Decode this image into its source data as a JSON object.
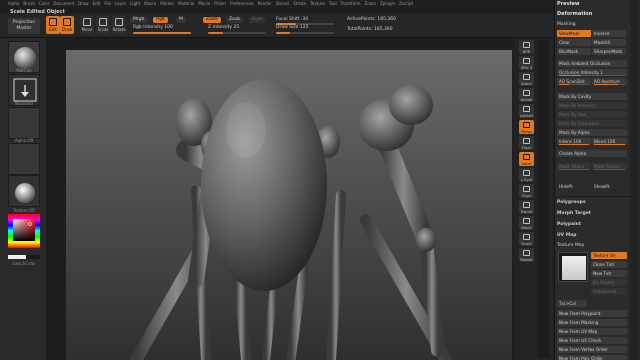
{
  "menu": [
    "Alpha",
    "Brush",
    "Color",
    "Document",
    "Draw",
    "Edit",
    "File",
    "Layer",
    "Light",
    "Macro",
    "Marker",
    "Material",
    "Movie",
    "Picker",
    "Preferences",
    "Render",
    "Stencil",
    "Stroke",
    "Texture",
    "Tool",
    "Transform",
    "Zoom",
    "Zplugin",
    "Zscript"
  ],
  "status_line": "Scale Edited Object",
  "shelf": {
    "projection_master": "Projection Master",
    "tools": [
      {
        "label": "Edit",
        "active": true
      },
      {
        "label": "Draw",
        "active": true
      },
      {
        "label": "Move",
        "active": false
      },
      {
        "label": "Scale",
        "active": false
      },
      {
        "label": "Rotate",
        "active": false
      }
    ],
    "mrgb": "Mrgb",
    "rgb": "Rgb",
    "m": "M",
    "rgb_intensity": "Rgb Intensity 100",
    "rgb_intensity_value": 1.0,
    "zadd": "Zadd",
    "zsub": "Zsub",
    "zcut": "Zcut",
    "z_intensity": "Z Intensity 25",
    "z_intensity_value": 0.25,
    "focal_shift": "Focal Shift -34",
    "draw_size": "Draw Size 125",
    "active_points": "ActivePoints: 185,360",
    "total_points": "TotalPoints: 185,360"
  },
  "left_panel": {
    "alpha_caption": "MatCap",
    "brush_caption": "Standard",
    "stroke_caption": "Alpha Off",
    "texture_caption": "Texture Off",
    "switch_color": "SwitchColor"
  },
  "right_column": [
    {
      "label": "BPR",
      "active": false
    },
    {
      "label": "SPix 3",
      "active": false
    },
    {
      "label": "Zoom",
      "active": false
    },
    {
      "label": "Actual",
      "active": false
    },
    {
      "label": "AAHalf",
      "active": false
    },
    {
      "label": "Persp",
      "active": true
    },
    {
      "label": "Floor",
      "active": false
    },
    {
      "label": "Local",
      "active": true
    },
    {
      "label": "L.Sym",
      "active": false
    },
    {
      "label": "Gxyz",
      "active": false
    },
    {
      "label": "Frame",
      "active": false
    },
    {
      "label": "Move",
      "active": false
    },
    {
      "label": "Scale",
      "active": false
    },
    {
      "label": "Rotate",
      "active": false
    }
  ],
  "tool_panel": {
    "preview": "Preview",
    "deformation": "Deformation",
    "masking": "Masking",
    "view_mask": "ViewMask",
    "inverse": "Inverse",
    "clear": "Clear",
    "mask_all": "MaskAll",
    "blur_mask": "BlurMask",
    "sharpen_mask": "SharpenMask",
    "mask_ambient_occlusion": "Mask Ambient Occlusion",
    "occlusion_intensity": "Occlusion Intensity 1",
    "ao_scandist": "AO ScanDist",
    "ao_aperture": "AO Aperture",
    "mask_by_cavity": "Mask By Cavity",
    "mask_by_intensity": "Mask By Intensity",
    "mask_by_hue": "Mask By Hue",
    "mask_by_saturation": "Mask By Saturation",
    "mask_by_alpha": "Mask By Alpha",
    "intens": "Intens 100",
    "blend": "Blend 100",
    "create_alpha": "Create Alpha",
    "mask_adjust_1": "Mask Adjust",
    "mask_adjust_2": "Mask Adjust",
    "hide_pt": "HidePt",
    "show_pt": "ShowPt",
    "polygroups": "Polygroups",
    "morph_target": "Morph Target",
    "polypaint": "Polypaint",
    "uv_map": "UV Map",
    "texture_map": "Texture Map",
    "texture_on": "Texture On",
    "clone_txtr": "Clone Txtr",
    "new_txtr": "New Txtr",
    "fix_seams": "Fix Seams",
    "antialiased": "Antialiased",
    "txr_col": "Txr>Col",
    "new_from_polypaint": "New From Polypaint",
    "new_from_masking": "New From Masking",
    "new_from_uv_map": "New From UV Map",
    "new_from_uv_check": "New From UV Check",
    "new_from_vertex_order": "New From Vertex Order",
    "new_from_poly_order": "New From Poly Order"
  },
  "colors": {
    "accent": "#e2781f",
    "panel": "#2b2b2b",
    "button": "#3a3a3a"
  }
}
